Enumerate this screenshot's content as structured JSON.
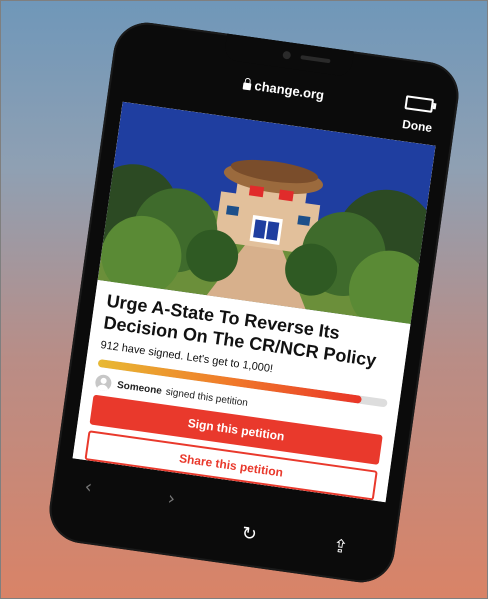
{
  "browser": {
    "url": "change.org",
    "done_label": "Done"
  },
  "petition": {
    "title": "Urge A-State To Reverse Its Decision On The CR/NCR Policy",
    "signed_text": "912 have signed. Let's get to 1,000!",
    "signed_count": 912,
    "goal": 1000,
    "progress_fraction": 0.912,
    "recent_signer_name": "Someone",
    "recent_signer_text": "signed this petition",
    "sign_button_label": "Sign this petition",
    "share_button_label": "Share this petition"
  },
  "nav_icons": {
    "back": "back-icon",
    "forward": "forward-icon",
    "reload": "reload-icon",
    "share": "share-icon"
  },
  "colors": {
    "accent_red": "#e9392c",
    "progress_start": "#e8b933",
    "progress_end": "#e93528"
  }
}
